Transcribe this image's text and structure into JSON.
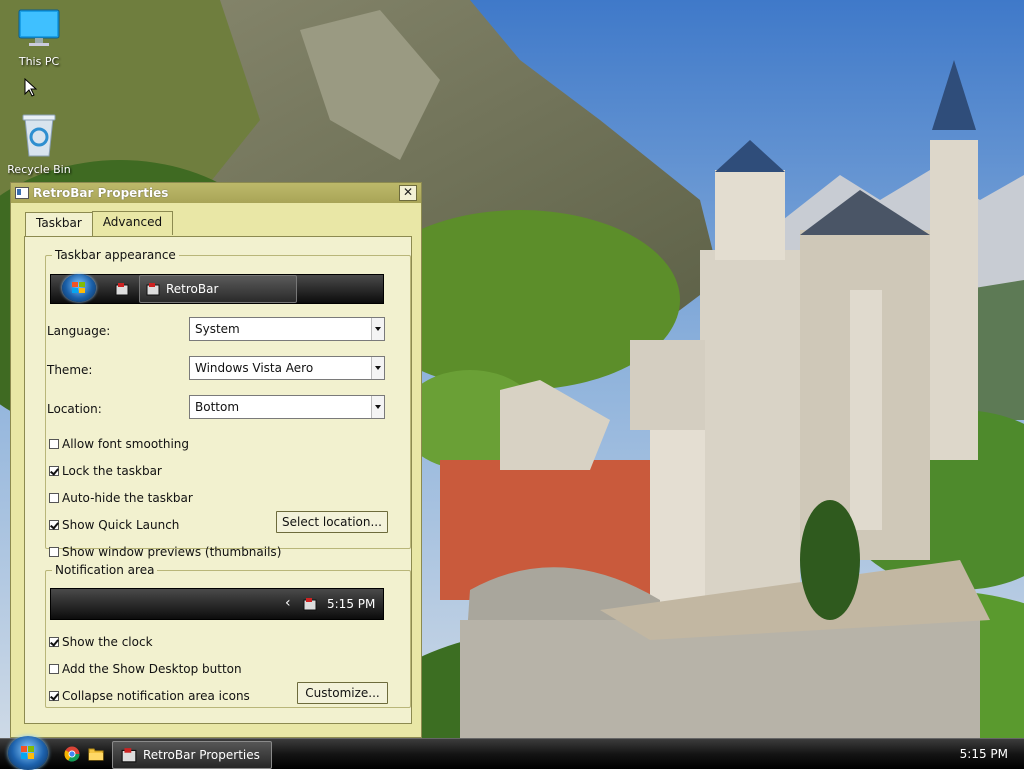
{
  "desktop": {
    "icons": [
      {
        "label": "This PC",
        "icon": "monitor-icon"
      },
      {
        "label": "Recycle Bin",
        "icon": "recycle-bin-icon"
      }
    ]
  },
  "window": {
    "title": "RetroBar Properties",
    "close_label": "✕",
    "tabs": [
      {
        "label": "Taskbar",
        "active": true
      },
      {
        "label": "Advanced",
        "active": false
      }
    ],
    "appearance": {
      "legend": "Taskbar appearance",
      "preview_task_label": "RetroBar"
    },
    "language": {
      "label": "Language:",
      "value": "System"
    },
    "theme": {
      "label": "Theme:",
      "value": "Windows Vista Aero"
    },
    "location": {
      "label": "Location:",
      "value": "Bottom"
    },
    "options": [
      {
        "label": "Allow font smoothing",
        "checked": false
      },
      {
        "label": "Lock the taskbar",
        "checked": true
      },
      {
        "label": "Auto-hide the taskbar",
        "checked": false
      },
      {
        "label": "Show Quick Launch",
        "checked": true
      },
      {
        "label": "Show window previews (thumbnails)",
        "checked": false
      }
    ],
    "select_location_button": "Select location...",
    "notification": {
      "legend": "Notification area",
      "preview_chevron": "‹",
      "preview_clock": "5:15 PM",
      "options": [
        {
          "label": "Show the clock",
          "checked": true
        },
        {
          "label": "Add the Show Desktop button",
          "checked": false
        },
        {
          "label": "Collapse notification area icons",
          "checked": true
        }
      ],
      "customize_button": "Customize..."
    }
  },
  "taskbar": {
    "quick_launch": [
      {
        "icon": "chrome-icon"
      },
      {
        "icon": "file-explorer-icon"
      }
    ],
    "task_label": "RetroBar Properties",
    "clock": "5:15 PM"
  },
  "colors": {
    "window_bg": "#e9e7a6",
    "titlebar": "#a8a457",
    "taskbar": "#141414"
  }
}
